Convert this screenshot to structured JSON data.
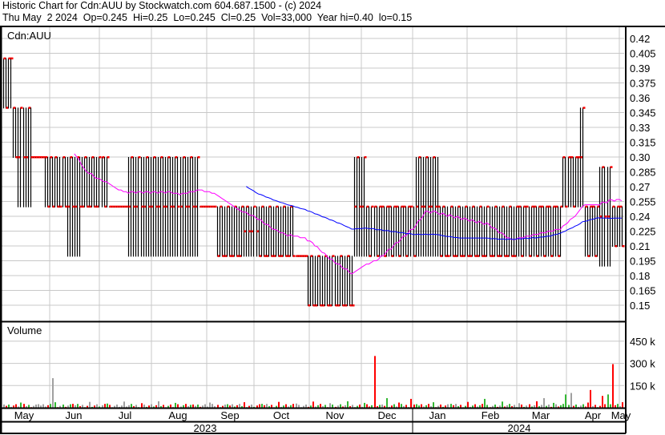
{
  "header": {
    "title": "Historic Chart for Cdn:AUU by Stockwatch.com 604.687.1500 - (c) 2024",
    "quote": "Thu May  2 2024  Op=0.245  Hi=0.25  Lo=0.245  Cl=0.25  Vol=33,000  Year hi=0.40  lo=0.15"
  },
  "chart_data": {
    "type": "line",
    "title": "Cdn:AUU",
    "price_axis": {
      "ticks": [
        "0.42",
        "0.405",
        "0.39",
        "0.375",
        "0.36",
        "0.345",
        "0.33",
        "0.315",
        "0.30",
        "0.285",
        "0.27",
        "0.255",
        "0.24",
        "0.225",
        "0.21",
        "0.195",
        "0.18",
        "0.165",
        "0.15"
      ],
      "ylim": [
        0.135,
        0.4275
      ]
    },
    "bar_runs_note": "[count, high, low, close]",
    "bar_runs": [
      [
        4,
        0.4,
        0.35,
        0.4
      ],
      [
        2,
        0.35,
        0.3,
        0.35
      ],
      [
        6,
        0.35,
        0.25,
        0.3
      ],
      [
        5,
        0.3,
        0.3,
        0.3
      ],
      [
        3,
        0.3,
        0.25,
        0.3
      ],
      [
        6,
        0.3,
        0.25,
        0.25
      ],
      [
        6,
        0.3,
        0.2,
        0.25
      ],
      [
        8,
        0.3,
        0.25,
        0.25
      ],
      [
        3,
        0.3,
        0.25,
        0.3
      ],
      [
        8,
        0.25,
        0.25,
        0.25
      ],
      [
        18,
        0.3,
        0.2,
        0.25
      ],
      [
        11,
        0.3,
        0.2,
        0.25
      ],
      [
        7,
        0.25,
        0.25,
        0.25
      ],
      [
        11,
        0.25,
        0.2,
        0.2
      ],
      [
        6,
        0.25,
        0.2,
        0.225
      ],
      [
        15,
        0.25,
        0.2,
        0.2
      ],
      [
        5,
        0.2,
        0.2,
        0.2
      ],
      [
        19,
        0.2,
        0.15,
        0.15
      ],
      [
        5,
        0.3,
        0.2,
        0.25
      ],
      [
        20,
        0.25,
        0.2,
        0.25
      ],
      [
        10,
        0.3,
        0.2,
        0.25
      ],
      [
        32,
        0.25,
        0.2,
        0.2
      ],
      [
        18,
        0.25,
        0.2,
        0.25
      ],
      [
        7,
        0.3,
        0.25,
        0.3
      ],
      [
        2,
        0.35,
        0.25,
        0.3
      ],
      [
        6,
        0.25,
        0.2,
        0.25
      ],
      [
        5,
        0.29,
        0.19,
        0.24
      ],
      [
        5,
        0.25,
        0.21,
        0.25
      ]
    ],
    "moving_averages": [
      {
        "name": "short MA",
        "period": 30,
        "color": "#ff00ff"
      },
      {
        "name": "long MA",
        "period": 100,
        "color": "#0000ff"
      }
    ],
    "volume": {
      "label": "Volume",
      "ticks": [
        {
          "label": "450 k",
          "value": 450
        },
        {
          "label": "300 k",
          "value": 300
        },
        {
          "label": "150 k",
          "value": 150
        }
      ],
      "ylim": [
        0,
        600
      ],
      "unit": "k",
      "spikes": [
        {
          "bar": 20,
          "value": 200,
          "dir": "flat"
        },
        {
          "bar": 151,
          "value": 350,
          "dir": "down"
        },
        {
          "bar": 248,
          "value": 295,
          "dir": "down"
        },
        {
          "bar": 239,
          "value": 120,
          "dir": "down"
        },
        {
          "bar": 231,
          "value": 100,
          "dir": "flat"
        },
        {
          "bar": 229,
          "value": 90,
          "dir": "up"
        },
        {
          "bar": 244,
          "value": 80,
          "dir": "down"
        },
        {
          "bar": 246,
          "value": 90,
          "dir": "up"
        },
        {
          "bar": 156,
          "value": 65,
          "dir": "up"
        },
        {
          "bar": 166,
          "value": 60,
          "dir": "down"
        },
        {
          "bar": 220,
          "value": 65,
          "dir": "flat"
        },
        {
          "bar": 196,
          "value": 60,
          "dir": "up"
        }
      ]
    },
    "months": [
      "May",
      "Jun",
      "Jul",
      "Aug",
      "Sep",
      "Oct",
      "Nov",
      "Dec",
      "Jan",
      "Feb",
      "Mar",
      "Apr",
      "May"
    ],
    "years": [
      "2023",
      "2024"
    ],
    "colors": {
      "up": "#33b833",
      "down": "#ff0000",
      "flat": "#a0a0a0",
      "grid": "#c8c8c8",
      "bar": "#000000",
      "close": "#ff0000"
    }
  }
}
